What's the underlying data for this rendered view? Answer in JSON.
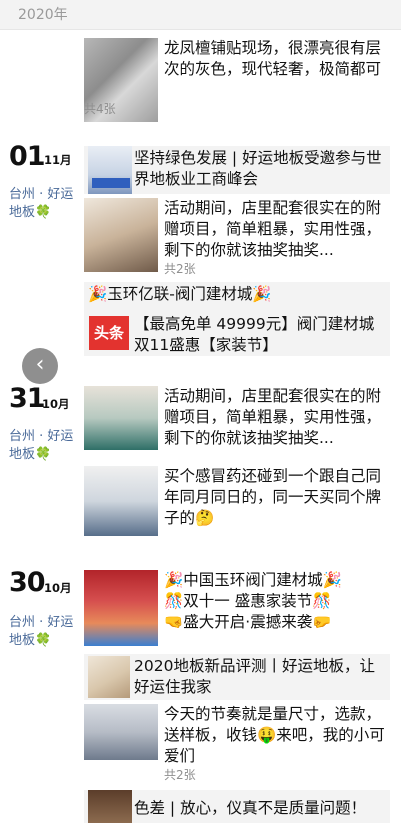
{
  "year_label": "2020年",
  "posts": [
    {
      "text": "龙凤檀铺贴现场，很漂亮很有层次的灰色，现代轻奢，极简都可",
      "count": "共4张"
    },
    {
      "text": "坚持绿色发展 | 好运地板受邀参与世界地板业工商峰会"
    },
    {
      "text": "活动期间，店里配套很实在的附赠项目，简单粗暴，实用性强，剩下的你就该抽奖抽奖...",
      "count": "共2张"
    },
    {
      "title": "🎉玉环亿联-阀门建材城🎉",
      "text": "【最高免单 49999元】阀门建材城双11盛惠【家装节】",
      "badge": "头条"
    },
    {
      "text": "活动期间，店里配套很实在的附赠项目，简单粗暴，实用性强，剩下的你就该抽奖抽奖..."
    },
    {
      "text": "买个感冒药还碰到一个跟自己同年同月同日的，同一天买同个牌子的🤔"
    },
    {
      "text": "🎉中国玉环阀门建材城🎉\n🎊双十一 盛惠家装节🎊\n🤜盛大开启·震撼来袭🤛"
    },
    {
      "text": "2020地板新品评测丨好运地板，让好运住我家"
    },
    {
      "text": "今天的节奏就是量尺寸，选款，送样板，收钱🤑来吧，我的小可爱们",
      "count": "共2张"
    },
    {
      "text": "色差 | 放心，仪真不是质量问题！"
    }
  ],
  "dates": [
    {
      "day": "01",
      "month": "11月",
      "location": "台州 · 好运地板🍀"
    },
    {
      "day": "31",
      "month": "10月",
      "location": "台州 · 好运地板🍀"
    },
    {
      "day": "30",
      "month": "10月",
      "location": "台州 · 好运地板🍀"
    }
  ],
  "back_button": "‹"
}
